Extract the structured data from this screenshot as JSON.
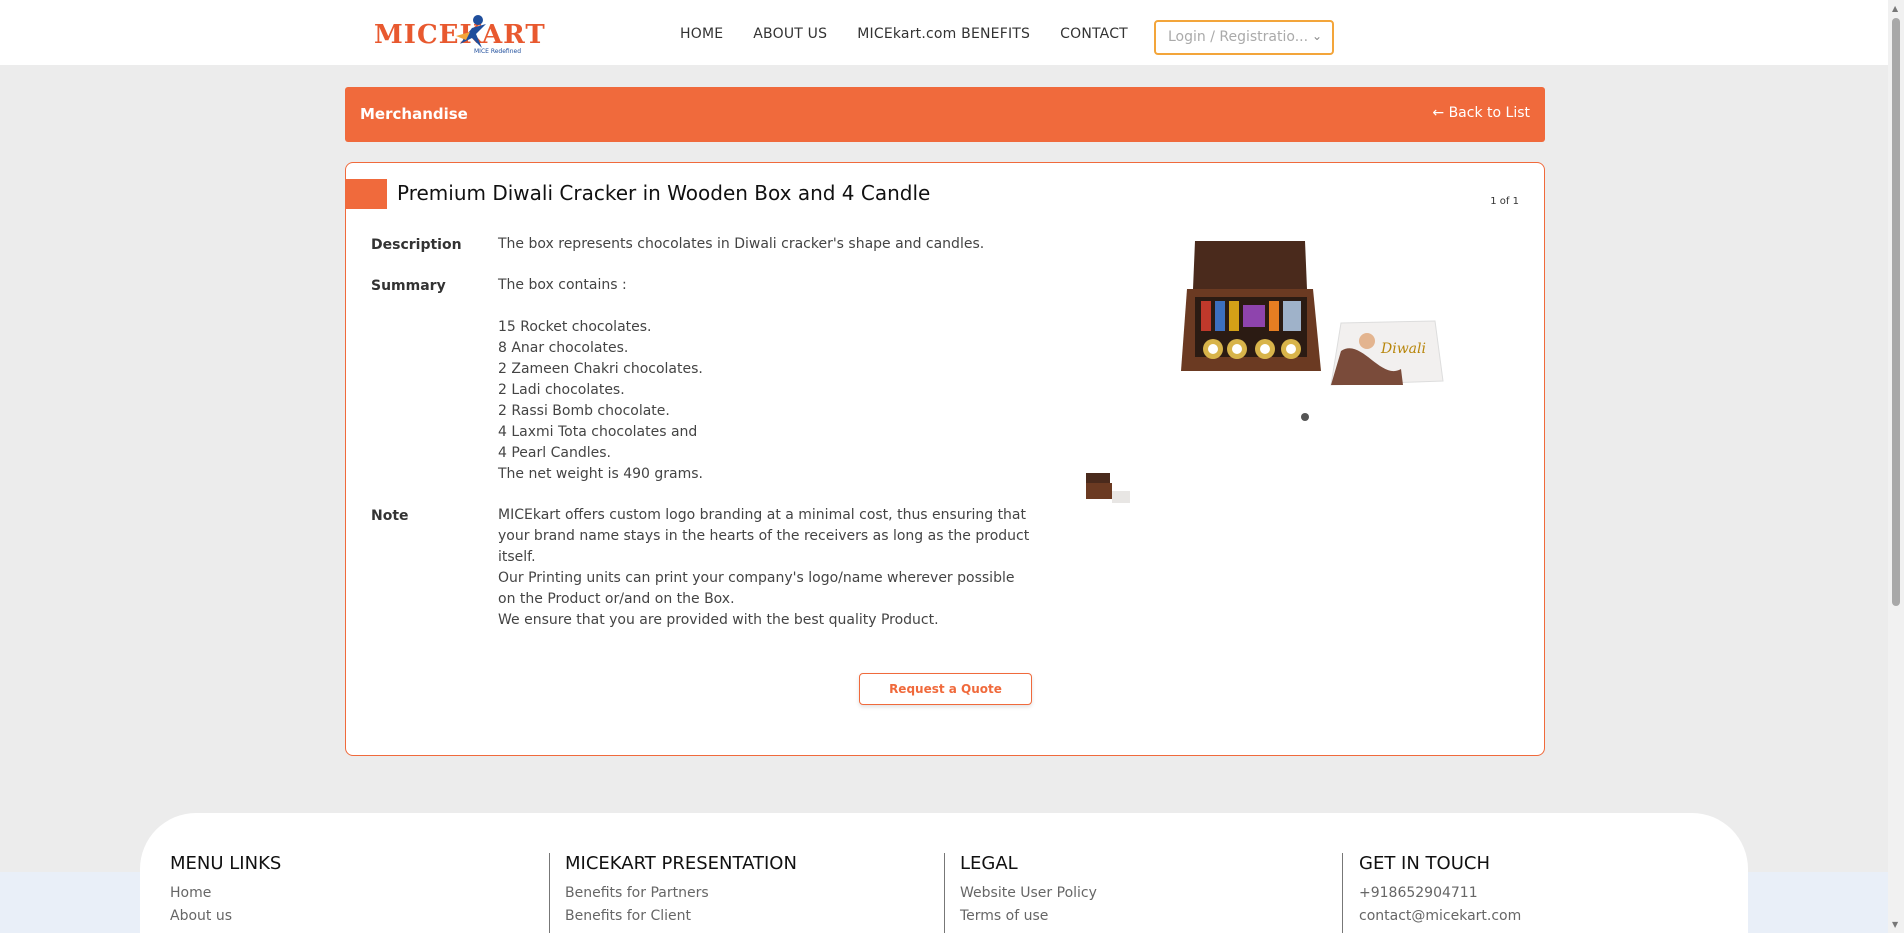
{
  "header": {
    "logo_text": "MICEKART",
    "logo_tagline": "MICE Redefined",
    "nav": [
      "HOME",
      "ABOUT US",
      "MICEkart.com BENEFITS",
      "CONTACT"
    ],
    "login_label": "Login / Registratio..."
  },
  "banner": {
    "title": "Merchandise",
    "back_label": "Back to List"
  },
  "product": {
    "title": "Premium Diwali Cracker in Wooden Box and 4 Candle",
    "image_counter": "1 of 1",
    "description_label": "Description",
    "description": "The box represents chocolates in Diwali cracker's shape and candles.",
    "summary_label": "Summary",
    "summary_lines": [
      "The box contains :",
      "",
      "15 Rocket chocolates.",
      "8 Anar chocolates.",
      "2 Zameen Chakri chocolates.",
      "2 Ladi chocolates.",
      "2 Rassi Bomb chocolate.",
      "4 Laxmi Tota chocolates and",
      "4 Pearl Candles.",
      "The net weight is 490 grams."
    ],
    "note_label": "Note",
    "note_lines": [
      "MICEkart offers custom logo branding at a minimal cost, thus ensuring that",
      "your brand name stays in the hearts of the receivers as long as the product",
      "itself.",
      "Our Printing units can print your company's logo/name wherever possible",
      "on the Product or/and on the Box.",
      "We ensure that you are provided with the best quality Product."
    ],
    "quote_button": "Request a Quote"
  },
  "footer": {
    "columns": [
      {
        "heading": "MENU LINKS",
        "links": [
          "Home",
          "About us"
        ]
      },
      {
        "heading": "MICEKART PRESENTATION",
        "links": [
          "Benefits for Partners",
          "Benefits for Client"
        ]
      },
      {
        "heading": "LEGAL",
        "links": [
          "Website User Policy",
          "Terms of use"
        ]
      },
      {
        "heading": "GET IN TOUCH",
        "links": [
          "+918652904711",
          "contact@micekart.com"
        ]
      }
    ]
  },
  "colors": {
    "accent": "#f06a3c",
    "login_border": "#f3a53a",
    "logo_blue": "#1f4e9c"
  }
}
